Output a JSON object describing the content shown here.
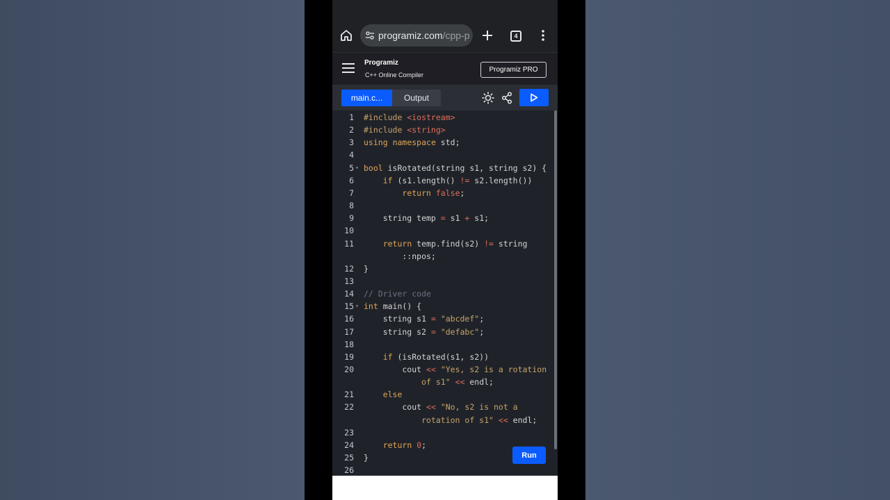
{
  "browser": {
    "url_domain": "programiz.com",
    "url_path": "/cpp-p",
    "tab_count": "4"
  },
  "site": {
    "logo": "Programiz",
    "subtitle": "C++ Online Compiler",
    "pro_button": "Programiz PRO"
  },
  "toolbar": {
    "tab_main": "main.c...",
    "tab_output": "Output"
  },
  "editor": {
    "run_label": "Run",
    "lines": [
      {
        "n": "1",
        "fold": false,
        "segs": [
          [
            "t-pre",
            "#include "
          ],
          [
            "t-inc",
            "<iostream>"
          ]
        ]
      },
      {
        "n": "2",
        "fold": false,
        "segs": [
          [
            "t-pre",
            "#include "
          ],
          [
            "t-inc",
            "<string>"
          ]
        ]
      },
      {
        "n": "3",
        "fold": false,
        "segs": [
          [
            "t-kw",
            "using"
          ],
          [
            "",
            "",
            " "
          ],
          [
            "t-kw",
            "namespace"
          ],
          [
            "",
            " std;"
          ]
        ]
      },
      {
        "n": "4",
        "fold": false,
        "segs": []
      },
      {
        "n": "5",
        "fold": true,
        "segs": [
          [
            "t-kw",
            "bool"
          ],
          [
            "",
            " isRotated(string s1, string s2) {"
          ]
        ]
      },
      {
        "n": "6",
        "fold": false,
        "segs": [
          [
            "",
            "    "
          ],
          [
            "t-kw",
            "if"
          ],
          [
            "",
            " (s1.length() "
          ],
          [
            "t-op",
            "!="
          ],
          [
            "",
            " s2.length())"
          ]
        ]
      },
      {
        "n": "7",
        "fold": false,
        "segs": [
          [
            "",
            "        "
          ],
          [
            "t-kw",
            "return"
          ],
          [
            "",
            " "
          ],
          [
            "t-num",
            "false"
          ],
          [
            "",
            ";"
          ]
        ]
      },
      {
        "n": "8",
        "fold": false,
        "segs": []
      },
      {
        "n": "9",
        "fold": false,
        "segs": [
          [
            "",
            "    string temp "
          ],
          [
            "t-op",
            "="
          ],
          [
            "",
            " s1 "
          ],
          [
            "t-op",
            "+"
          ],
          [
            "",
            " s1;"
          ]
        ]
      },
      {
        "n": "10",
        "fold": false,
        "segs": []
      },
      {
        "n": "11",
        "fold": false,
        "segs": [
          [
            "",
            "    "
          ],
          [
            "t-kw",
            "return"
          ],
          [
            "",
            " temp.find(s2) "
          ],
          [
            "t-op",
            "!="
          ],
          [
            "",
            " string"
          ]
        ]
      },
      {
        "n": "",
        "fold": false,
        "segs": [
          [
            "",
            "        ::npos;"
          ]
        ]
      },
      {
        "n": "12",
        "fold": false,
        "segs": [
          [
            "",
            "}"
          ]
        ]
      },
      {
        "n": "13",
        "fold": false,
        "segs": []
      },
      {
        "n": "14",
        "fold": false,
        "segs": [
          [
            "t-com",
            "// Driver code"
          ]
        ]
      },
      {
        "n": "15",
        "fold": true,
        "segs": [
          [
            "t-kw",
            "int"
          ],
          [
            "",
            " main() {"
          ]
        ]
      },
      {
        "n": "16",
        "fold": false,
        "segs": [
          [
            "",
            "    string s1 "
          ],
          [
            "t-op",
            "="
          ],
          [
            "",
            " "
          ],
          [
            "t-str",
            "\"abcdef\""
          ],
          [
            "",
            ";"
          ]
        ]
      },
      {
        "n": "17",
        "fold": false,
        "segs": [
          [
            "",
            "    string s2 "
          ],
          [
            "t-op",
            "="
          ],
          [
            "",
            " "
          ],
          [
            "t-str",
            "\"defabc\""
          ],
          [
            "",
            ";"
          ]
        ]
      },
      {
        "n": "18",
        "fold": false,
        "segs": []
      },
      {
        "n": "19",
        "fold": false,
        "segs": [
          [
            "",
            "    "
          ],
          [
            "t-kw",
            "if"
          ],
          [
            "",
            " (isRotated(s1, s2))"
          ]
        ]
      },
      {
        "n": "20",
        "fold": false,
        "segs": [
          [
            "",
            "        cout "
          ],
          [
            "t-op",
            "<<"
          ],
          [
            "",
            " "
          ],
          [
            "t-str",
            "\"Yes, s2 is a rotation"
          ]
        ]
      },
      {
        "n": "",
        "fold": false,
        "segs": [
          [
            "",
            "            "
          ],
          [
            "t-str",
            "of s1\""
          ],
          [
            "",
            " "
          ],
          [
            "t-op",
            "<<"
          ],
          [
            "",
            " endl;"
          ]
        ]
      },
      {
        "n": "21",
        "fold": false,
        "segs": [
          [
            "",
            "    "
          ],
          [
            "t-kw",
            "else"
          ]
        ]
      },
      {
        "n": "22",
        "fold": false,
        "segs": [
          [
            "",
            "        cout "
          ],
          [
            "t-op",
            "<<"
          ],
          [
            "",
            " "
          ],
          [
            "t-str",
            "\"No, s2 is not a"
          ]
        ]
      },
      {
        "n": "",
        "fold": false,
        "segs": [
          [
            "",
            "            "
          ],
          [
            "t-str",
            "rotation of s1\""
          ],
          [
            "",
            " "
          ],
          [
            "t-op",
            "<<"
          ],
          [
            "",
            " endl;"
          ]
        ]
      },
      {
        "n": "23",
        "fold": false,
        "segs": []
      },
      {
        "n": "24",
        "fold": false,
        "segs": [
          [
            "",
            "    "
          ],
          [
            "t-kw",
            "return"
          ],
          [
            "",
            " "
          ],
          [
            "t-num",
            "0"
          ],
          [
            "",
            ";"
          ]
        ]
      },
      {
        "n": "25",
        "fold": false,
        "segs": [
          [
            "",
            "}"
          ]
        ]
      },
      {
        "n": "26",
        "fold": false,
        "segs": []
      }
    ]
  }
}
